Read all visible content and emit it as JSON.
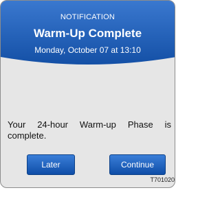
{
  "notification": {
    "category": "NOTIFICATION",
    "title": "Warm-Up Complete",
    "datetime": "Monday, October 07 at 13:10",
    "message": "Your 24-hour Warm-up Phase is complete.",
    "buttons": {
      "later": "Later",
      "continue": "Continue"
    },
    "figure_code": "T701020"
  },
  "colors": {
    "header_blue": "#1d5db3",
    "button_blue": "#1a5bb6",
    "dialog_bg": "#e6e6e6"
  }
}
